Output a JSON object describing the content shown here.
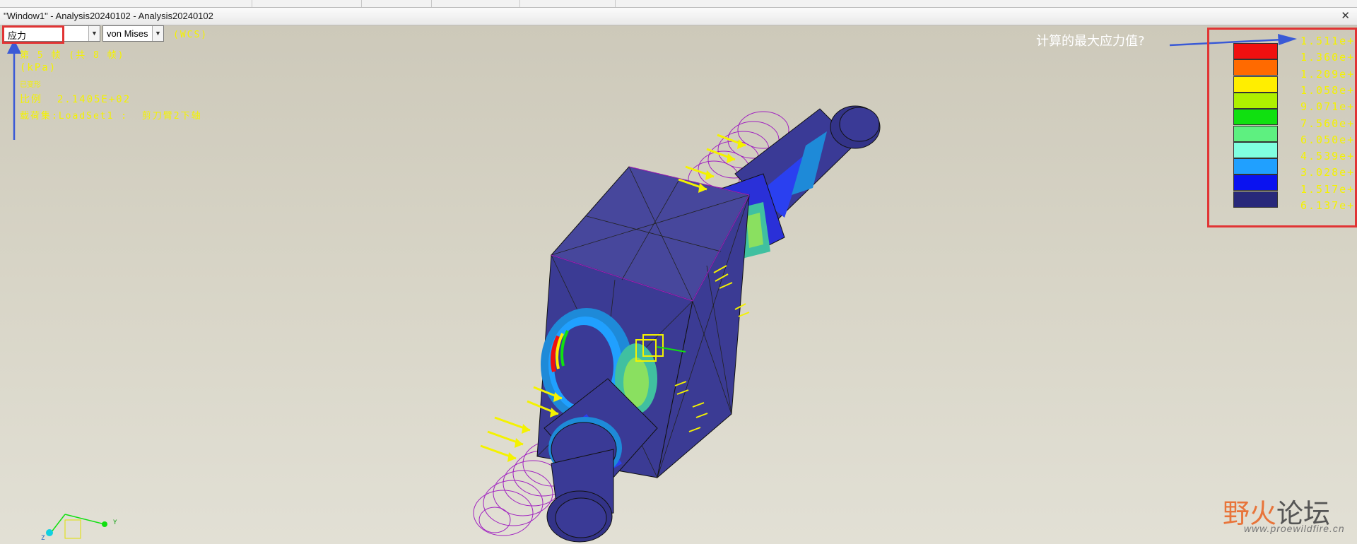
{
  "window": {
    "title": "\"Window1\" - Analysis20240102 - Analysis20240102"
  },
  "toolbar": {
    "result_type": "应力",
    "component": "von Mises",
    "coord_system": "(WCS)"
  },
  "info": {
    "step": "第 5 帧 (共 8 帧)",
    "units": "(kPa)",
    "deformed": "已变形",
    "scale": "比例  2.1405E+02",
    "loadset": "载荷集:LoadSet1 :  剪刀臂2下轴"
  },
  "annotation": "计算的最大应力值?",
  "legend": {
    "labels": [
      "1.511e+",
      "1.360e+",
      "1.209e+",
      "1.058e+",
      "9.071e+",
      "7.560e+",
      "6.050e+",
      "4.539e+",
      "3.028e+",
      "1.517e+",
      "6.137e+"
    ],
    "colors": [
      "#f01010",
      "#ff6a00",
      "#ffee00",
      "#aef000",
      "#10e010",
      "#5ef080",
      "#80ffe0",
      "#20a0ff",
      "#0a12f0",
      "#28287a"
    ]
  },
  "axes": {
    "y": "Y",
    "z": "Z"
  },
  "watermark": {
    "brand1": "野火",
    "brand2": "论坛",
    "url": "www.proewildfire.cn"
  },
  "colors": {
    "label_yellow": "#f4f200",
    "highlight_red": "#e13434",
    "arrow_blue": "#3a5ad6",
    "mesh_purple": "#a020c0",
    "model_base": "#3a3a96"
  }
}
